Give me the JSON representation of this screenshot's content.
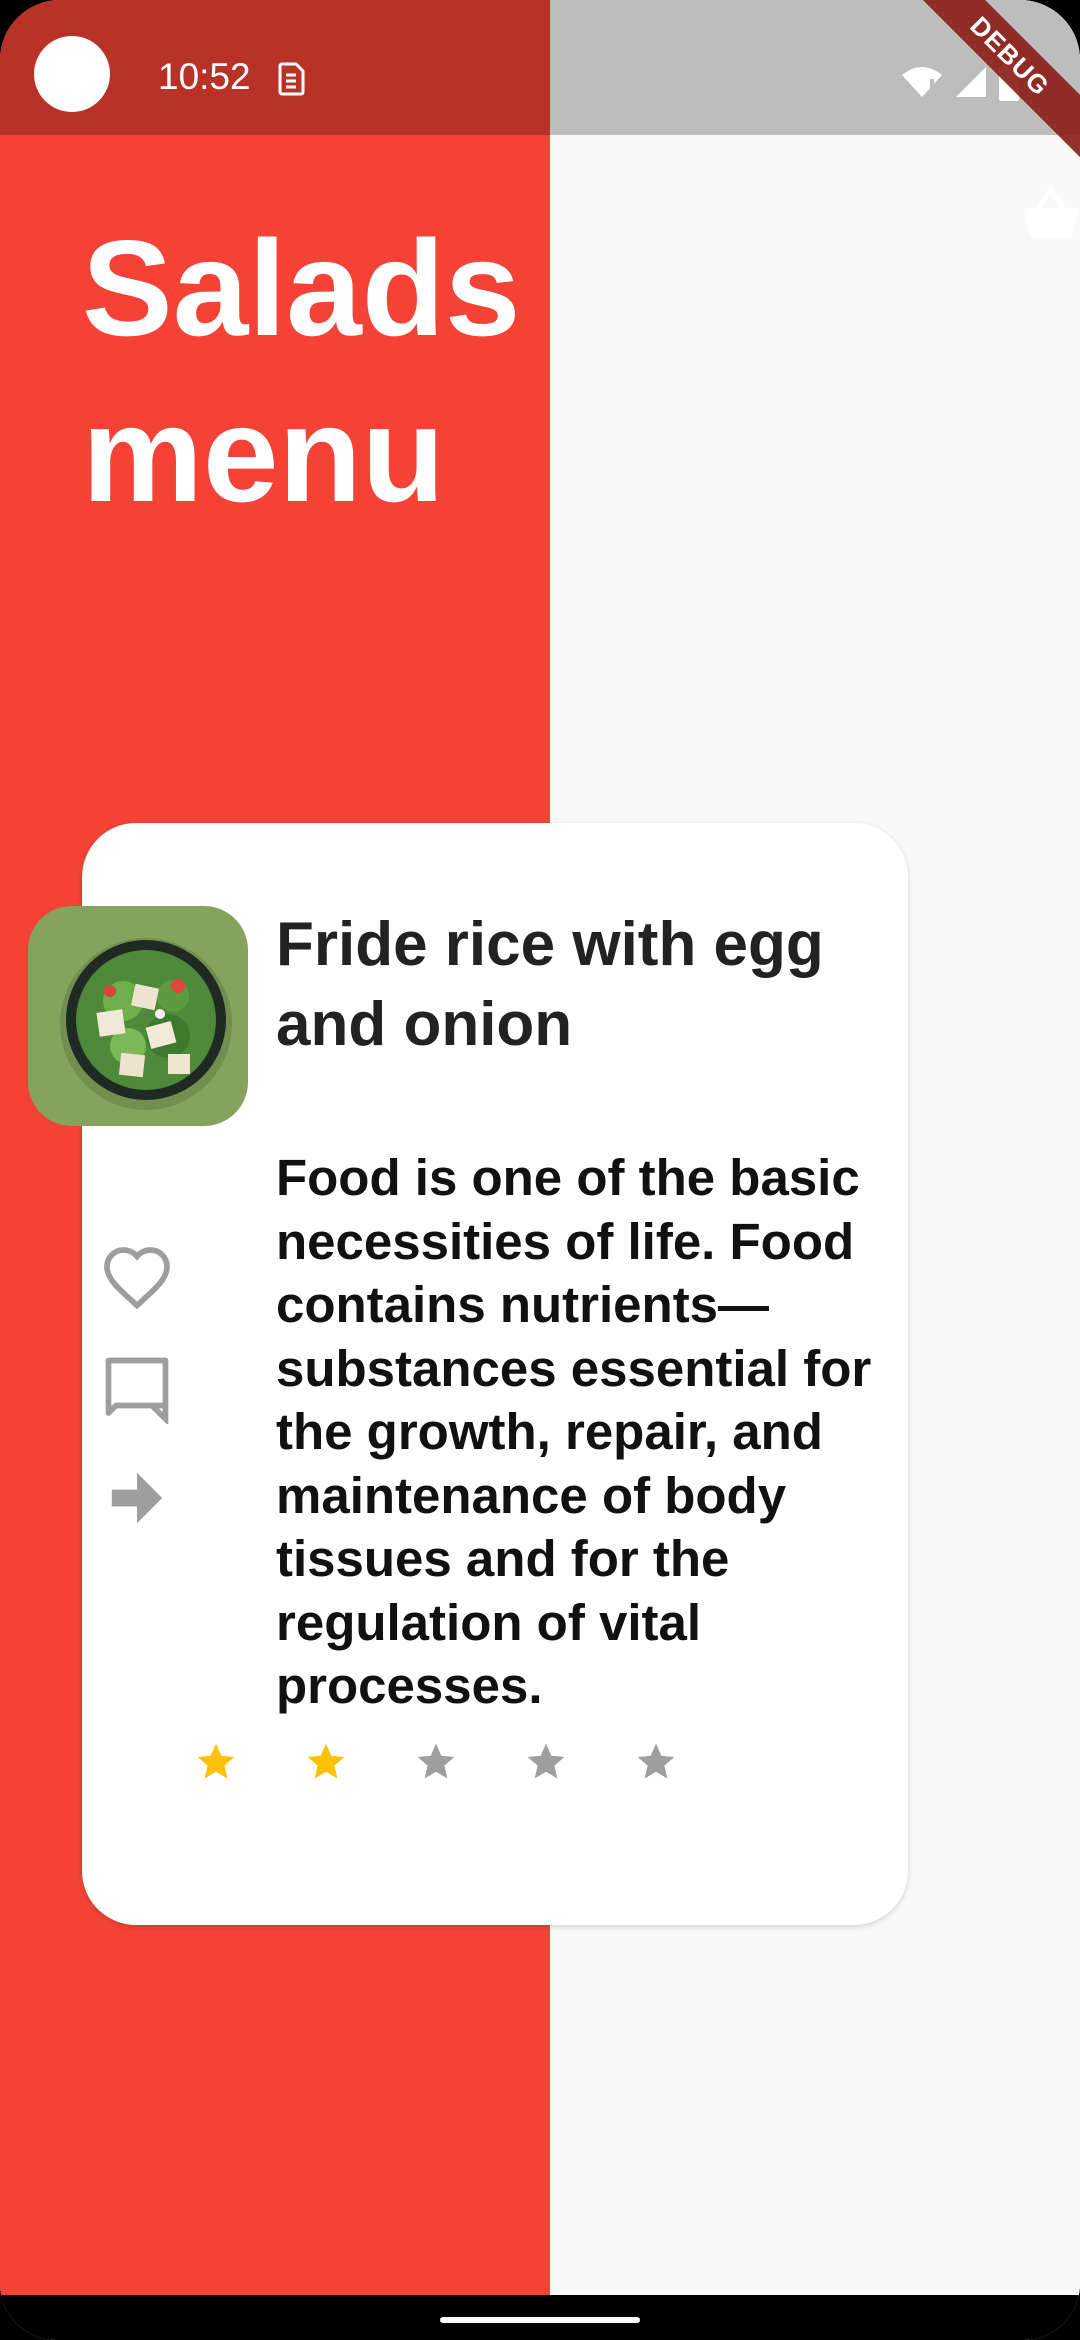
{
  "status_bar": {
    "time": "10:52",
    "debug_label": "DEBUG"
  },
  "header": {
    "title": "Salads menu"
  },
  "card": {
    "title": "Fride rice with egg and onion",
    "description": "Food is one of the basic necessities of life. Food contains nutrients—substances essential for the growth, repair, and maintenance of body tissues and for the regulation of vital processes.",
    "image_alt": "salad bowl",
    "actions": [
      "heart-icon",
      "comment-icon",
      "share-arrow-icon"
    ],
    "rating": {
      "value": 2,
      "max": 5
    }
  },
  "colors": {
    "primary_red": "#F44336",
    "status_red": "#B83228",
    "star_filled": "#FFC107",
    "star_empty": "#9E9E9E",
    "icon_gray": "#9E9E9E"
  }
}
